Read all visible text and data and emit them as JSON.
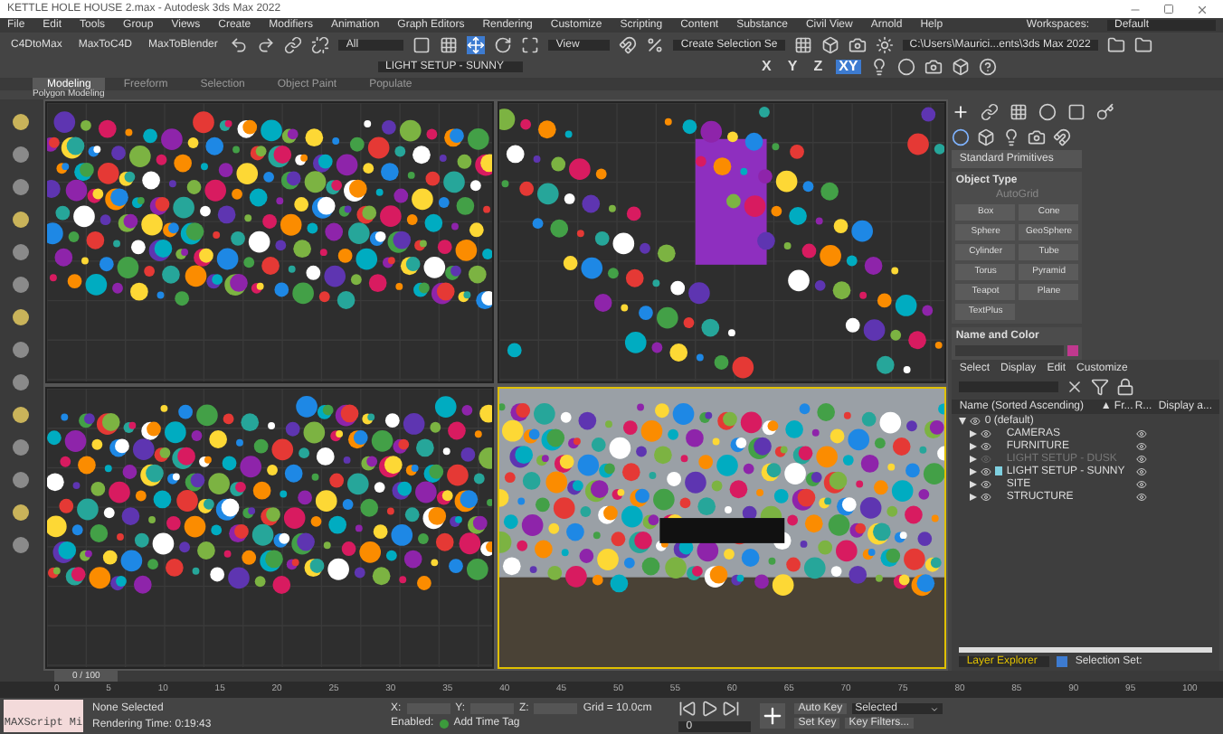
{
  "window": {
    "title": "KETTLE HOLE HOUSE 2.max - Autodesk 3ds Max 2022"
  },
  "menu": [
    "File",
    "Edit",
    "Tools",
    "Group",
    "Views",
    "Create",
    "Modifiers",
    "Animation",
    "Graph Editors",
    "Rendering",
    "Customize",
    "Scripting",
    "Content",
    "Substance",
    "Civil View",
    "Arnold",
    "Help"
  ],
  "workspaces": {
    "label": "Workspaces:",
    "value": "Default"
  },
  "toolbar": {
    "scripts": [
      "C4DtoMax",
      "MaxToC4D",
      "MaxToBlender"
    ],
    "filter": "All",
    "coordinate": "View",
    "selection_set": "Create Selection Se",
    "project_path": "C:\\Users\\Maurici...ents\\3ds Max 2022",
    "layer": "LIGHT SETUP - SUNNY",
    "axes": [
      {
        "label": "X",
        "selected": false
      },
      {
        "label": "Y",
        "selected": false
      },
      {
        "label": "Z",
        "selected": false
      },
      {
        "label": "XY",
        "selected": true
      }
    ]
  },
  "ribbon_tabs": [
    {
      "label": "Modeling",
      "selected": true
    },
    {
      "label": "Freeform",
      "selected": false
    },
    {
      "label": "Selection",
      "selected": false
    },
    {
      "label": "Object Paint",
      "selected": false
    },
    {
      "label": "Populate",
      "selected": false
    }
  ],
  "ribbon_panel": "Polygon Modeling",
  "command_panel": {
    "category": "Standard Primitives",
    "object_type": "Object Type",
    "autogrid": {
      "label": "AutoGrid",
      "disabled": true
    },
    "buttons": [
      "Box",
      "Cone",
      "Sphere",
      "GeoSphere",
      "Cylinder",
      "Tube",
      "Torus",
      "Pyramid",
      "Teapot",
      "Plane",
      "TextPlus"
    ],
    "name_and_color": "Name and Color",
    "color": "#c0398f"
  },
  "scene_explorer": {
    "tabs": [
      "Select",
      "Display",
      "Edit",
      "Customize"
    ],
    "columns": [
      "Name (Sorted Ascending)",
      "▲ Fr...",
      "R...",
      "Display a..."
    ],
    "layers": [
      {
        "name": "0 (default)",
        "expanded": true,
        "children": [
          {
            "name": "CAMERAS",
            "active": false,
            "disabled": false
          },
          {
            "name": "FURNITURE",
            "active": false,
            "disabled": false
          },
          {
            "name": "LIGHT SETUP - DUSK",
            "active": false,
            "disabled": true
          },
          {
            "name": "LIGHT SETUP - SUNNY",
            "active": true,
            "disabled": false
          },
          {
            "name": "SITE",
            "active": false,
            "disabled": false
          },
          {
            "name": "STRUCTURE",
            "active": false,
            "disabled": false
          }
        ]
      }
    ],
    "explorer_name": "Layer Explorer",
    "selection_set": "Selection Set:"
  },
  "timeline": {
    "frame": "0 / 100",
    "level": 0,
    "ticks": [
      "0",
      "5",
      "10",
      "15",
      "20",
      "25",
      "30",
      "35",
      "40",
      "45",
      "50",
      "55",
      "60",
      "65",
      "70",
      "75",
      "80",
      "85",
      "90",
      "95",
      "100"
    ]
  },
  "status_bar": {
    "maxscript": "MAXScript Mi",
    "selection": "None Selected",
    "render_time": "Rendering Time: 0:19:43",
    "x": "X:",
    "y": "Y:",
    "z": "Z:",
    "grid": "Grid = 10.0cm",
    "enabled": "Enabled:",
    "add_time_tag": "Add Time Tag",
    "auto_key": "Auto Key",
    "key_mode": "Selected",
    "set_key": "Set Key",
    "key_filters": "Key Filters...",
    "frame_field": "0"
  }
}
